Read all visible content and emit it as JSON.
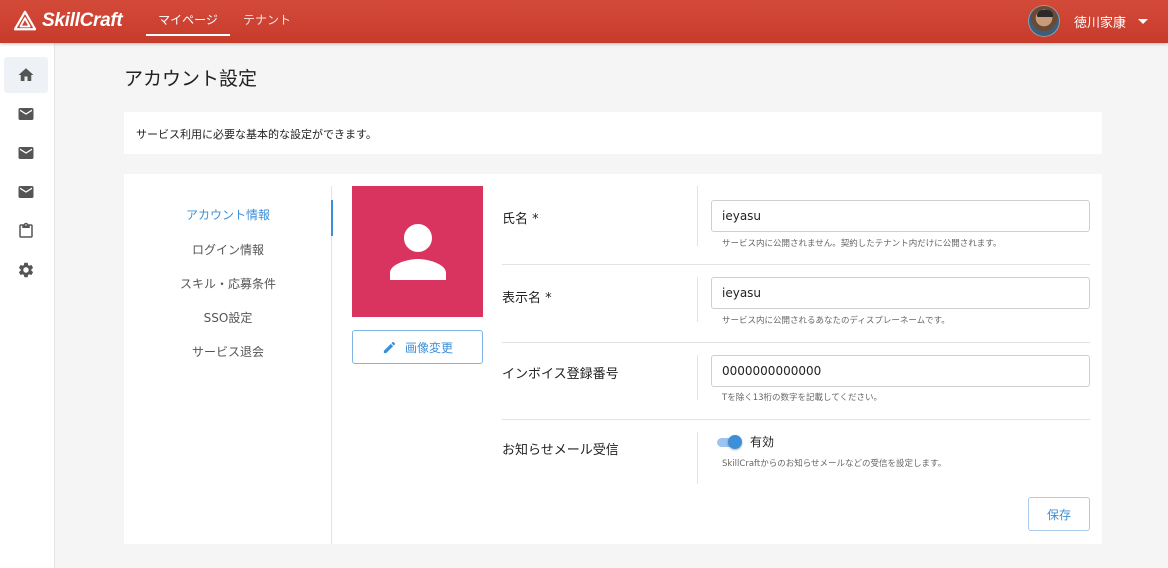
{
  "header": {
    "logo_text": "SkillCraft",
    "tabs": [
      {
        "label": "マイページ",
        "active": true
      },
      {
        "label": "テナント",
        "active": false
      }
    ],
    "user_name": "徳川家康"
  },
  "sidebar": {
    "items": [
      {
        "icon": "home-icon",
        "active": true
      },
      {
        "icon": "mail-icon"
      },
      {
        "icon": "mail-icon"
      },
      {
        "icon": "mail-icon"
      },
      {
        "icon": "clipboard-icon"
      },
      {
        "icon": "gear-icon"
      }
    ]
  },
  "page": {
    "title": "アカウント設定",
    "description": "サービス利用に必要な基本的な設定ができます。"
  },
  "settings_menu": {
    "items": [
      {
        "label": "アカウント情報",
        "active": true
      },
      {
        "label": "ログイン情報"
      },
      {
        "label": "スキル・応募条件"
      },
      {
        "label": "SSO設定"
      },
      {
        "label": "サービス退会"
      }
    ]
  },
  "profile_image": {
    "change_label": "画像変更"
  },
  "form": {
    "full_name": {
      "label": "氏名 *",
      "value": "ieyasu",
      "hint": "サービス内に公開されません。契約したテナント内だけに公開されます。"
    },
    "display_name": {
      "label": "表示名 *",
      "value": "ieyasu",
      "hint": "サービス内に公開されるあなたのディスプレーネームです。"
    },
    "invoice_number": {
      "label": "インボイス登録番号",
      "value": "0000000000000",
      "hint": "Tを除く13桁の数字を記載してください。"
    },
    "notification_email": {
      "label": "お知らせメール受信",
      "toggle_on": true,
      "toggle_label": "有効",
      "hint": "SkillCraftからのお知らせメールなどの受信を設定します。"
    },
    "save_label": "保存"
  },
  "colors": {
    "header": "#c93f2f",
    "accent": "#3d8fd8",
    "avatar_bg": "#d9345f"
  }
}
